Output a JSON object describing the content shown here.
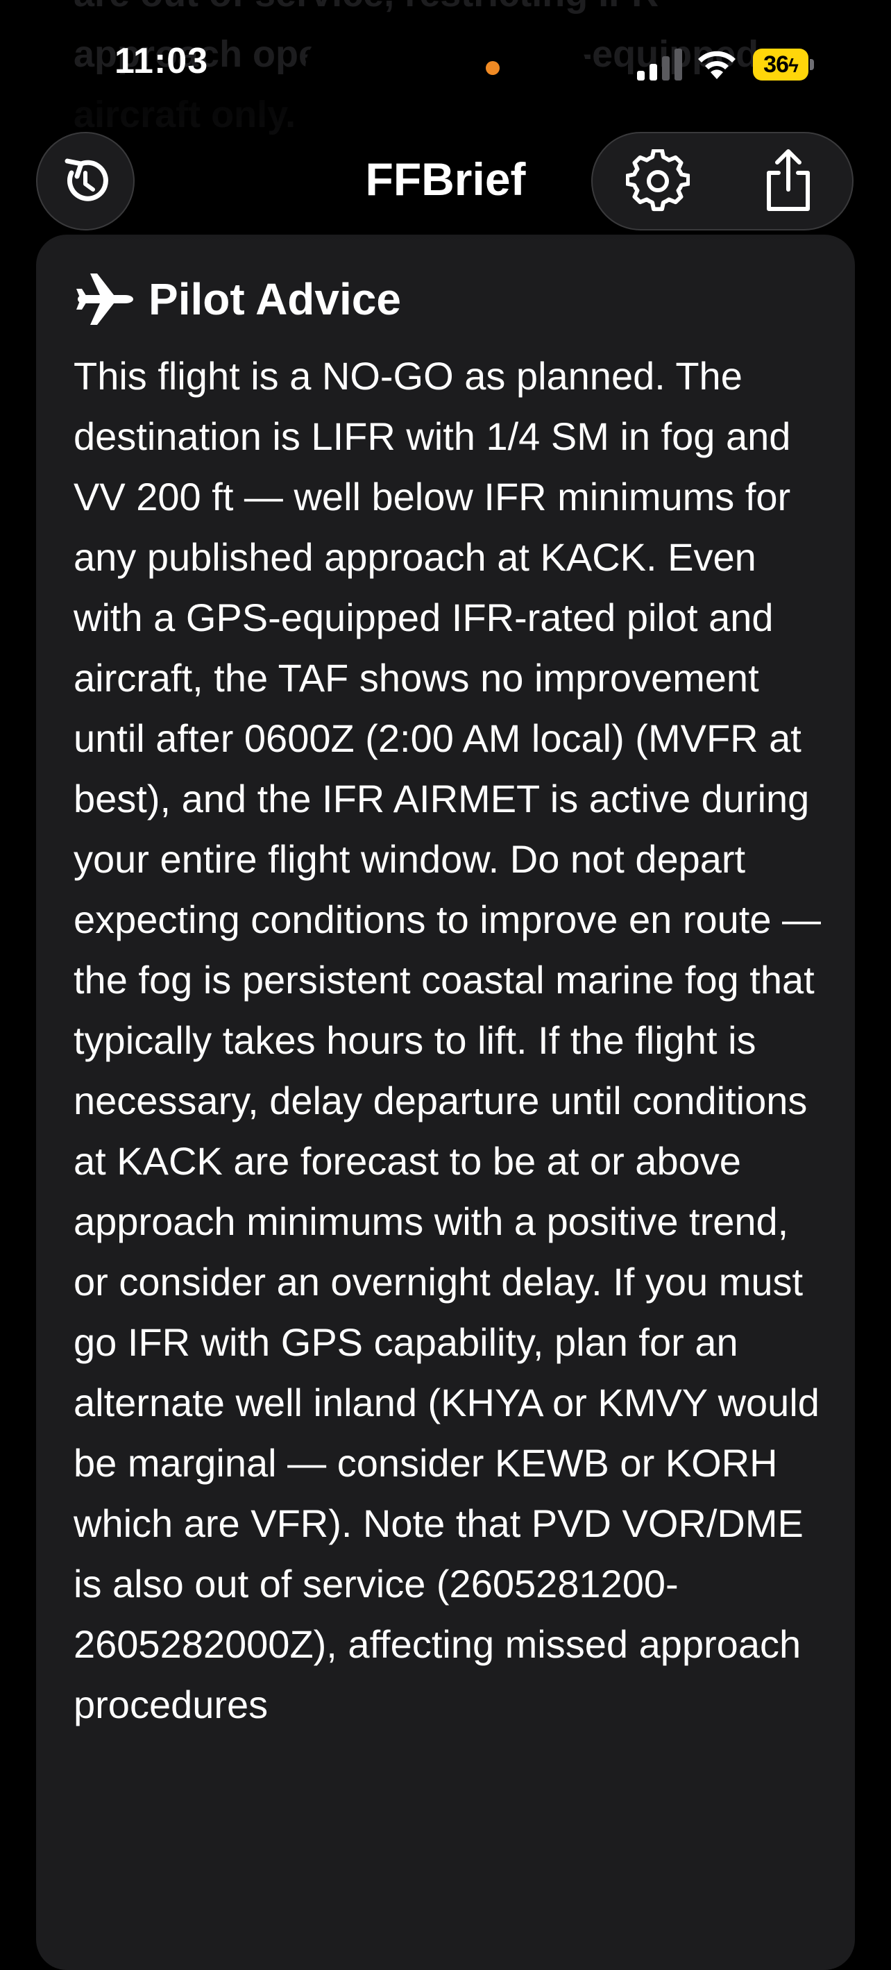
{
  "status_bar": {
    "time": "11:03",
    "battery_level": "36",
    "accent_colors": {
      "battery": "#ffd60a",
      "privacy_dot": "#f08a24"
    }
  },
  "background_text": "are out of service, restricting IFR approach operations to GPS-equipped aircraft only.",
  "nav": {
    "title": "FFBrief",
    "left_button_icon": "refresh-icon",
    "right_buttons": [
      {
        "icon": "gear-icon"
      },
      {
        "icon": "share-icon"
      }
    ]
  },
  "card": {
    "icon": "airplane-icon",
    "title": "Pilot Advice",
    "body": "This flight is a NO-GO as planned. The destination is LIFR with 1/4 SM in fog and VV 200 ft — well below IFR minimums for any published approach at KACK. Even with a GPS-equipped IFR-rated pilot and aircraft, the TAF shows no improvement until after 0600Z (2:00 AM local) (MVFR at best), and the IFR AIRMET is active during your entire flight window. Do not depart expecting conditions to improve en route — the fog is persistent coastal marine fog that typically takes hours to lift. If the flight is necessary, delay departure until conditions at KACK are forecast to be at or above approach minimums with a positive trend, or consider an overnight delay. If you must go IFR with GPS capability, plan for an alternate well inland (KHYA or KMVY would be marginal — consider KEWB or KORH which are VFR). Note that PVD VOR/DME is also out of service (2605281200-2605282000Z), affecting missed approach procedures"
  }
}
